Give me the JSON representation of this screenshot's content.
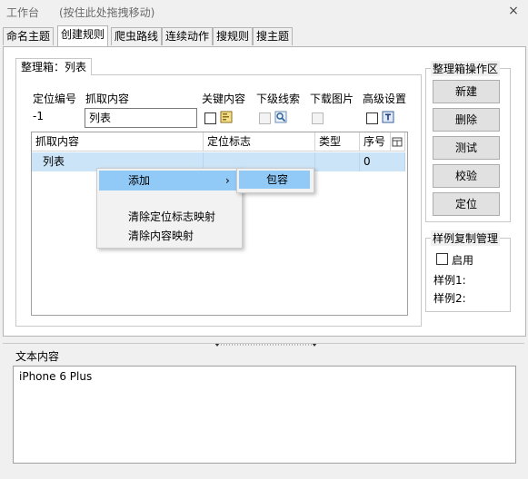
{
  "window": {
    "title": "工作台",
    "drag_hint": "(按住此处拖拽移动)",
    "close_glyph": "×"
  },
  "tabs": [
    {
      "label": "命名主题"
    },
    {
      "label": "创建规则",
      "active": true
    },
    {
      "label": "爬虫路线"
    },
    {
      "label": "连续动作"
    },
    {
      "label": "搜规则"
    },
    {
      "label": "搜主题"
    }
  ],
  "box": {
    "tab_label": "整理箱：列表",
    "fields": {
      "position_no_label": "定位编号",
      "position_no_value": "-1",
      "content_label": "抓取内容",
      "content_value": "列表",
      "keyword_label": "关键内容",
      "sub_clue_label": "下级线索",
      "download_img_label": "下载图片",
      "advanced_label": "高级设置"
    },
    "grid": {
      "columns": [
        "抓取内容",
        "定位标志",
        "类型",
        "序号"
      ],
      "rows": [
        [
          "列表",
          "",
          "",
          "0"
        ]
      ]
    }
  },
  "ops": {
    "title": "整理箱操作区",
    "buttons": [
      "新建",
      "删除",
      "测试",
      "校验",
      "定位"
    ]
  },
  "sample": {
    "title": "样例复制管理",
    "enable_label": "启用",
    "sample1_label": "样例1:",
    "sample2_label": "样例2:"
  },
  "context_menu": {
    "items": [
      "添加",
      "清除定位标志映射",
      "清除内容映射"
    ],
    "submenu_arrow": "›",
    "submenu_items": [
      "包容"
    ]
  },
  "text_panel": {
    "label": "文本内容",
    "value": "iPhone 6 Plus"
  },
  "colors": {
    "selection": "#cce4f7",
    "menu_highlight": "#91c9f7",
    "background": "#f0f0f0"
  }
}
